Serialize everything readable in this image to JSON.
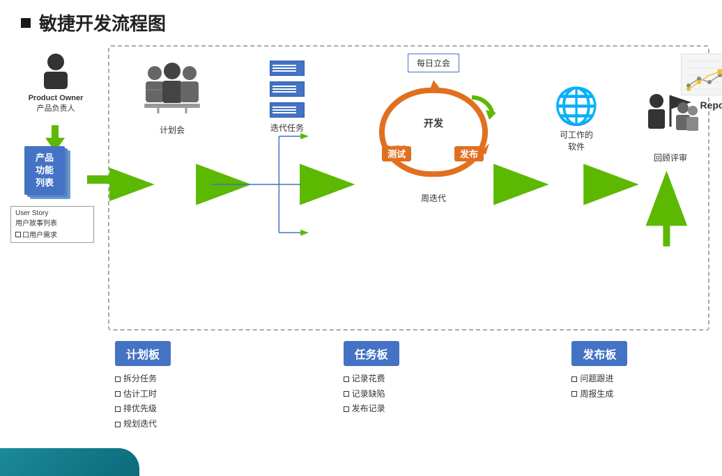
{
  "title": {
    "prefix": "■",
    "text": "敏捷开发流程图"
  },
  "left": {
    "person_label_en": "Product Owner",
    "person_label_cn": "产品负责人",
    "product_box": [
      "产品",
      "功能",
      "列表"
    ],
    "userstory_en": "User Story",
    "userstory_cn": "用户故事列表",
    "req_label": "口用户需求"
  },
  "flow": {
    "meeting_label": "计划会",
    "iteration_label": "迭代任务",
    "standup_label": "每日立会",
    "dev_label": "开发",
    "test_label": "测试",
    "release_label": "发布",
    "sprint_label": "周迭代",
    "globe_label": "可工作的\n软件",
    "review_label": "回顾评审",
    "report_label": "Report"
  },
  "boards": {
    "plan": {
      "title": "计划板",
      "items": [
        "口拆分任务",
        "口估计工时",
        "口排优先级",
        "口规划迭代"
      ]
    },
    "task": {
      "title": "任务板",
      "items": [
        "口记录花费",
        "口记录缺陷",
        "口发布记录"
      ]
    },
    "release": {
      "title": "发布板",
      "items": [
        "口问题跟进",
        "口周报生成"
      ]
    }
  }
}
